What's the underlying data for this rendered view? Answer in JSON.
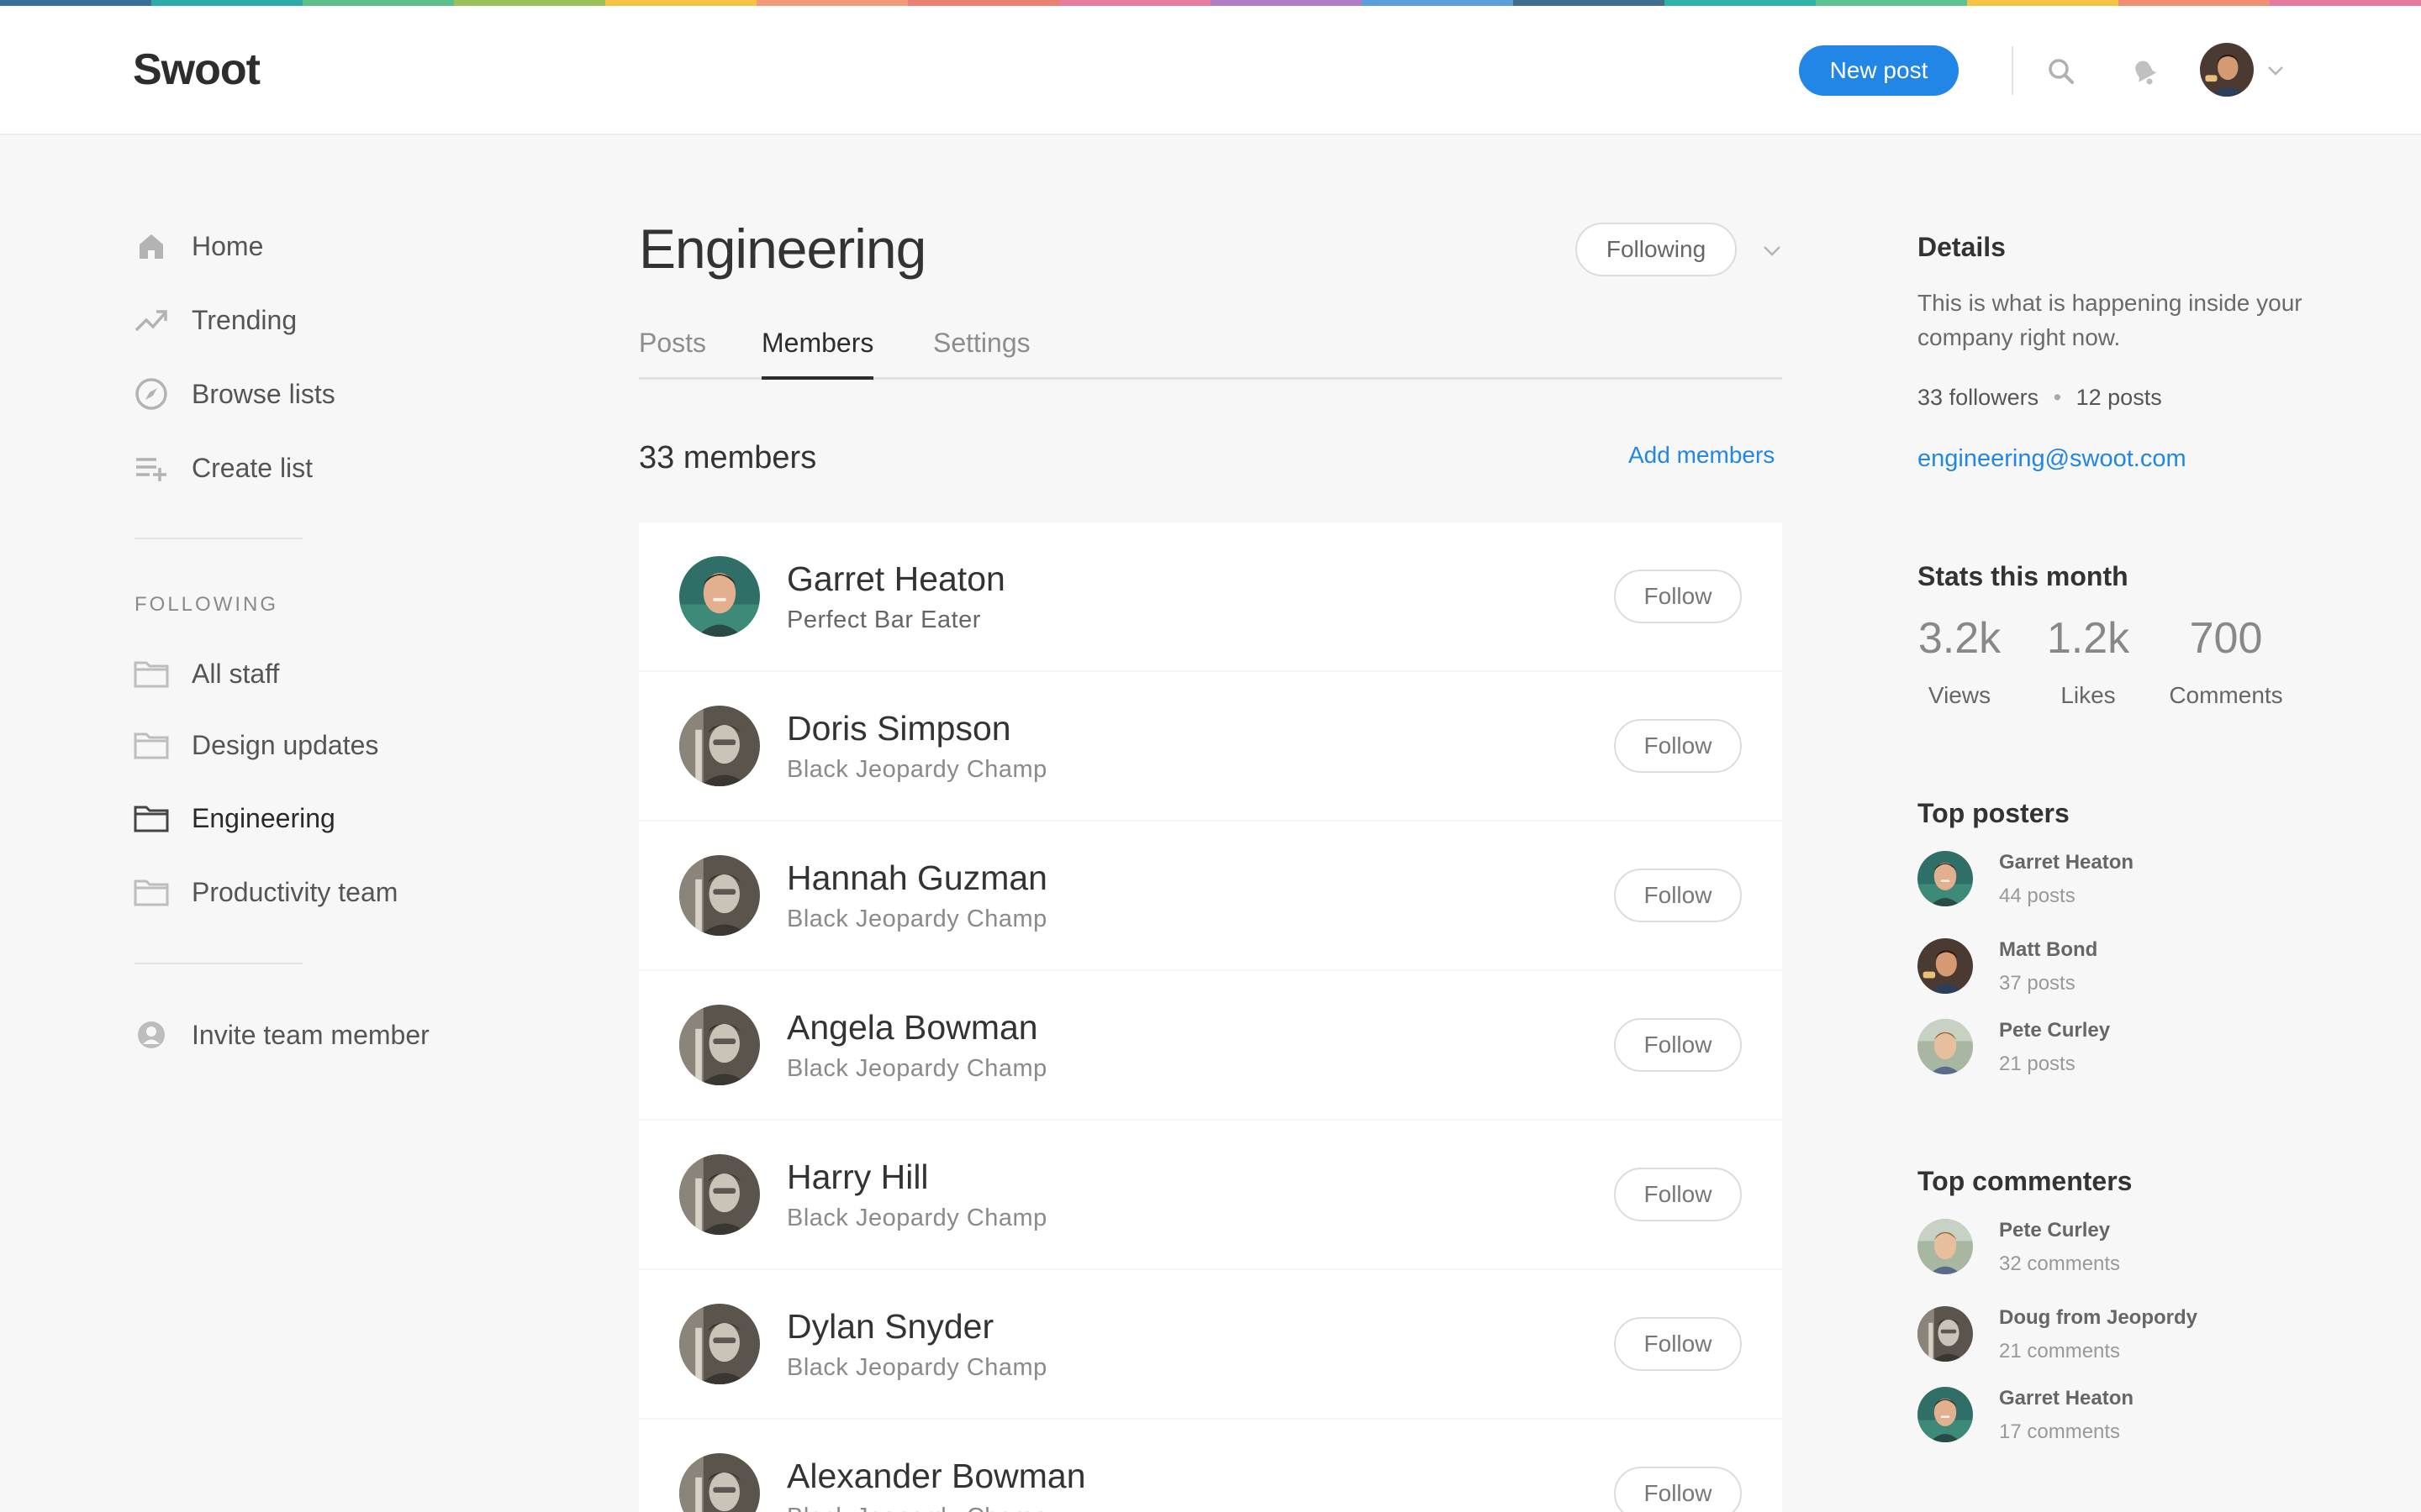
{
  "brand": {
    "name": "Swoot",
    "accent": "#2286e6",
    "stripe_colors": [
      "#3a6f9a",
      "#2eaaa6",
      "#5cbf8a",
      "#9bc15a",
      "#f5c243",
      "#f09a79",
      "#ec7f6f",
      "#e87ba0",
      "#b07cc6",
      "#5b9fd9",
      "#3f6e8f",
      "#2eb3a8",
      "#5cc28f",
      "#f5c243",
      "#ef8f74",
      "#e77aa0"
    ]
  },
  "header": {
    "new_post_label": "New post",
    "search_icon": "search-icon",
    "notifications_icon": "bell-icon",
    "account_chevron_icon": "chevron-down-icon"
  },
  "sidebar": {
    "nav": [
      {
        "label": "Home",
        "icon": "home-icon"
      },
      {
        "label": "Trending",
        "icon": "trending-icon"
      },
      {
        "label": "Browse lists",
        "icon": "compass-icon"
      },
      {
        "label": "Create list",
        "icon": "add-list-icon"
      }
    ],
    "following_label": "FOLLOWING",
    "following": [
      {
        "label": "All staff",
        "icon": "folder-icon",
        "active": false
      },
      {
        "label": "Design updates",
        "icon": "folder-icon",
        "active": false
      },
      {
        "label": "Engineering",
        "icon": "folder-icon",
        "active": true
      },
      {
        "label": "Productivity team",
        "icon": "folder-icon",
        "active": false
      }
    ],
    "invite_label": "Invite team member"
  },
  "main": {
    "title": "Engineering",
    "following_button": "Following",
    "tabs": [
      {
        "label": "Posts",
        "active": false
      },
      {
        "label": "Members",
        "active": true
      },
      {
        "label": "Settings",
        "active": false
      }
    ],
    "members_count": "33 members",
    "add_members": "Add members",
    "follow_label": "Follow",
    "members": [
      {
        "name": "Garret Heaton",
        "role": "Perfect Bar Eater"
      },
      {
        "name": "Doris Simpson",
        "role": "Black Jeopardy Champ"
      },
      {
        "name": "Hannah Guzman",
        "role": "Black Jeopardy Champ"
      },
      {
        "name": "Angela Bowman",
        "role": "Black Jeopardy Champ"
      },
      {
        "name": "Harry Hill",
        "role": "Black Jeopardy Champ"
      },
      {
        "name": "Dylan Snyder",
        "role": "Black Jeopardy Champ"
      },
      {
        "name": "Alexander Bowman",
        "role": "Black Jeopardy Champ"
      }
    ]
  },
  "details": {
    "heading": "Details",
    "description": "This is what is happening inside your company right now.",
    "followers_num": "33",
    "followers_label": "followers",
    "posts_num": "12",
    "posts_label": "posts",
    "email": "engineering@swoot.com"
  },
  "stats": {
    "heading": "Stats this month",
    "items": [
      {
        "value": "3.2k",
        "label": "Views"
      },
      {
        "value": "1.2k",
        "label": "Likes"
      },
      {
        "value": "700",
        "label": "Comments"
      }
    ]
  },
  "top_posters": {
    "heading": "Top posters",
    "items": [
      {
        "name": "Garret Heaton",
        "count": "44 posts"
      },
      {
        "name": "Matt Bond",
        "count": "37 posts"
      },
      {
        "name": "Pete Curley",
        "count": "21 posts"
      }
    ]
  },
  "top_commenters": {
    "heading": "Top commenters",
    "items": [
      {
        "name": "Pete Curley",
        "count": "32 comments"
      },
      {
        "name": "Doug from Jeopordy",
        "count": "21 comments"
      },
      {
        "name": "Garret Heaton",
        "count": "17 comments"
      }
    ]
  }
}
